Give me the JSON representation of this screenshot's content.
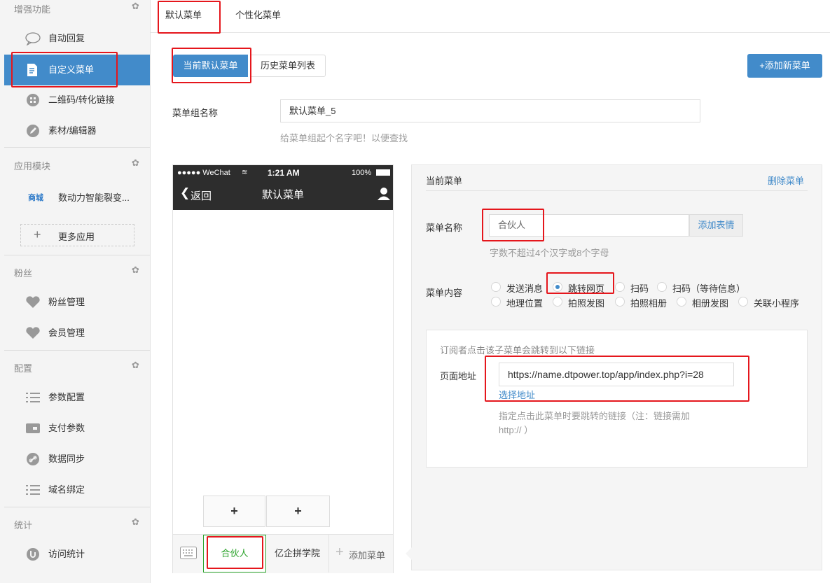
{
  "sidebar": {
    "sections": [
      {
        "title": "增强功能"
      },
      {
        "title": "应用模块"
      },
      {
        "title": "粉丝"
      },
      {
        "title": "配置"
      },
      {
        "title": "统计"
      }
    ],
    "items": {
      "auto_reply": "自动回复",
      "custom_menu": "自定义菜单",
      "qrcode": "二维码/转化链接",
      "material": "素材/编辑器",
      "app_tag": "商城",
      "app_name": "数动力智能裂变...",
      "more_apps": "更多应用",
      "fans_manage": "粉丝管理",
      "member_manage": "会员管理",
      "param_config": "参数配置",
      "pay_params": "支付参数",
      "data_sync": "数据同步",
      "domain_bind": "域名绑定",
      "visit_stats": "访问统计"
    }
  },
  "tabs": {
    "default_menu": "默认菜单",
    "personal_menu": "个性化菜单"
  },
  "toolbar": {
    "current_default": "当前默认菜单",
    "history_list": "历史菜单列表",
    "add_new": "+添加新菜单"
  },
  "group": {
    "label": "菜单组名称",
    "value": "默认菜单_5",
    "hint": "给菜单组起个名字吧！以便查找"
  },
  "phone": {
    "carrier": "●●●●● WeChat",
    "time": "1:21 AM",
    "battery": "100%",
    "back": "返回",
    "title": "默认菜单",
    "plus": "+",
    "keyboard_icon": "keyboard-icon",
    "menus": [
      "合伙人",
      "亿企拼学院",
      "添加菜单"
    ]
  },
  "editor": {
    "title": "当前菜单",
    "delete": "删除菜单",
    "name_label": "菜单名称",
    "name_value": "合伙人",
    "emoji_btn": "添加表情",
    "name_hint": "字数不超过4个汉字或8个字母",
    "content_label": "菜单内容",
    "options": [
      "发送消息",
      "跳转网页",
      "扫码",
      "扫码（等待信息）",
      "地理位置",
      "拍照发图",
      "拍照相册",
      "相册发图",
      "关联小程序"
    ],
    "selected": "跳转网页",
    "box_intro": "订阅者点击该子菜单会跳转到以下链接",
    "url_label": "页面地址",
    "url_value": "https://name.dtpower.top/app/index.php?i=28",
    "choose_link": "选择地址",
    "url_hint_1": "指定点击此菜单时要跳转的链接（注：链接需加",
    "url_hint_2": "http:// ）"
  },
  "colors": {
    "accent": "#428bca",
    "highlight": "#e5161c",
    "green": "#2aa22a"
  }
}
